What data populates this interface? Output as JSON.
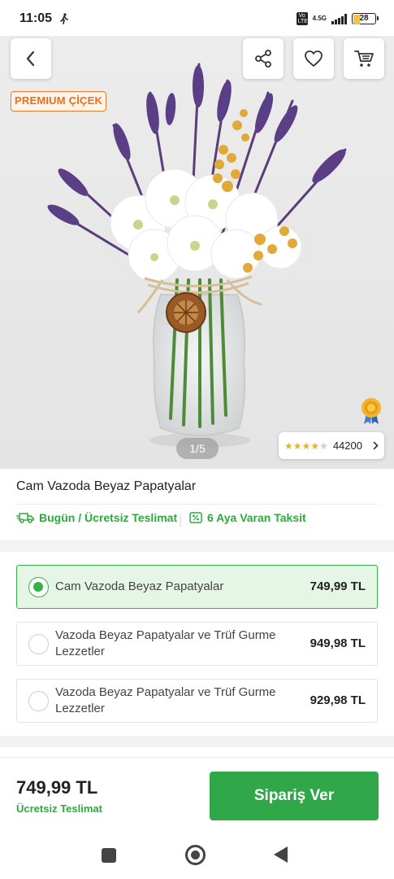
{
  "status_bar": {
    "time": "11:05",
    "volte": "Vo LTE",
    "network": "4.5G",
    "battery": "28",
    "battery_level": 0.28
  },
  "hero": {
    "premium_badge": "PREMIUM ÇİÇEK",
    "pager": "1/5",
    "rating_stars": 4,
    "rating_count": "44200",
    "star_color": "#f2b01e"
  },
  "product": {
    "title": "Cam Vazoda Beyaz Papatyalar",
    "delivery_perk": "Bugün / Ücretsiz Teslimat",
    "installment_perk": "6 Aya Varan Taksit"
  },
  "options": [
    {
      "label": "Cam Vazoda Beyaz Papatyalar",
      "price": "749,99 TL",
      "selected": true
    },
    {
      "label": "Vazoda Beyaz Papatyalar ve Trüf Gurme Lezzetler",
      "price": "949,98 TL",
      "selected": false
    },
    {
      "label": "Vazoda Beyaz Papatyalar ve Trüf Gurme Lezzetler",
      "price": "929,98 TL",
      "selected": false
    }
  ],
  "checkout": {
    "total_price": "749,99 TL",
    "delivery_note": "Ücretsiz Teslimat",
    "order_button": "Sipariş Ver"
  },
  "colors": {
    "accent_green": "#30a84a",
    "premium_orange": "#e86f1c"
  },
  "icons": {
    "back": "chevron-left-icon",
    "share": "share-icon",
    "favorite": "heart-icon",
    "cart": "cart-icon",
    "award": "award-icon",
    "delivery": "delivery-truck-icon",
    "installment": "installment-card-icon"
  }
}
